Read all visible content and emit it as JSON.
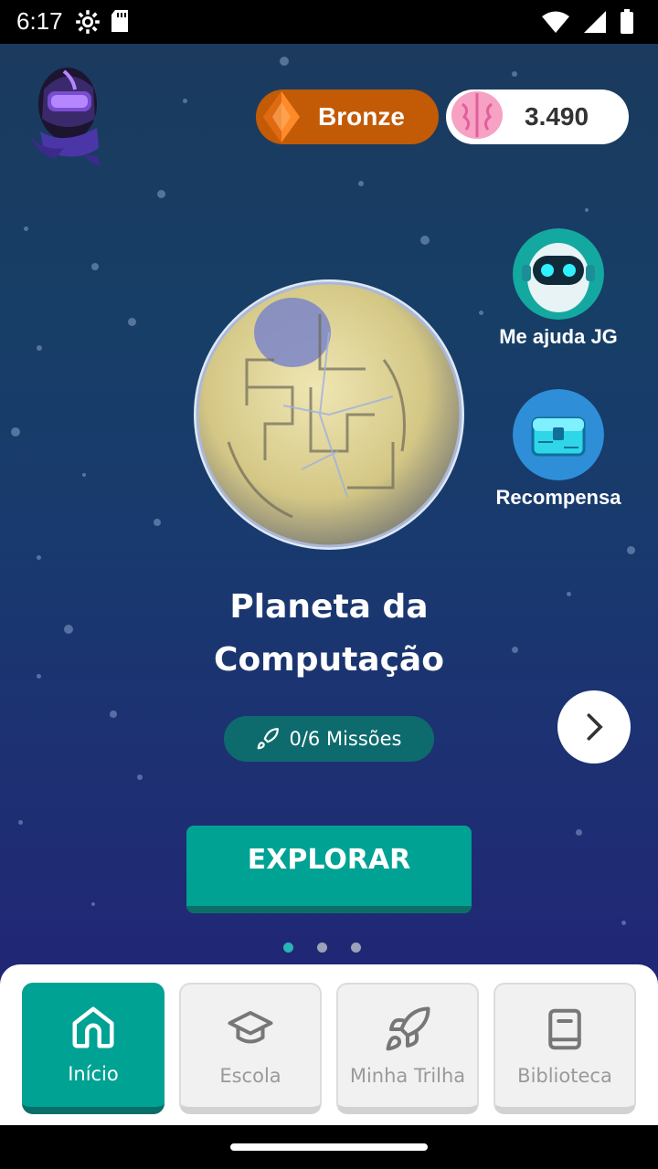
{
  "status": {
    "time": "6:17"
  },
  "header": {
    "rank_label": "Bronze",
    "points": "3.490"
  },
  "side_buttons": {
    "help_label": "Me ajuda JG",
    "reward_label": "Recompensa"
  },
  "planet": {
    "title_line1": "Planeta da",
    "title_line2": "Computação",
    "missions": "0/6 Missões",
    "explore_label": "EXPLORAR"
  },
  "carousel": {
    "pages": 3,
    "active": 1
  },
  "nav": {
    "items": [
      {
        "label": "Início",
        "icon": "home-icon"
      },
      {
        "label": "Escola",
        "icon": "graduation-cap-icon"
      },
      {
        "label": "Minha Trilha",
        "icon": "rocket-icon"
      },
      {
        "label": "Biblioteca",
        "icon": "book-icon"
      }
    ],
    "active": 0
  },
  "colors": {
    "accent": "#00a294",
    "bronze": "#c35a06",
    "missions_bg": "#0d6b6e"
  }
}
